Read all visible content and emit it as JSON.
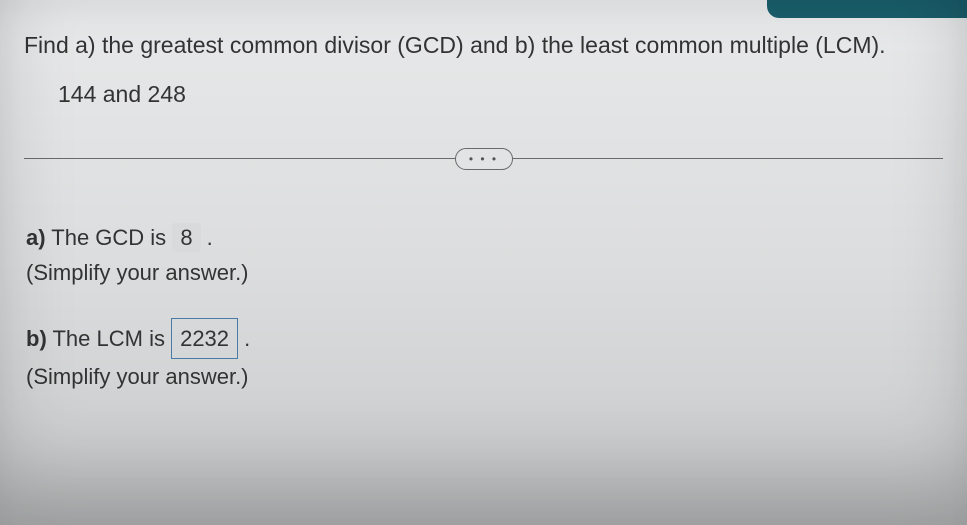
{
  "question": {
    "prompt": "Find a) the greatest common divisor (GCD) and b) the least common multiple (LCM).",
    "numbers": "144 and 248"
  },
  "divider": {
    "label": "• • •"
  },
  "parts": {
    "a": {
      "label": "a)",
      "text_before": " The GCD is ",
      "value": "8",
      "text_after": " .",
      "hint": "(Simplify your answer.)"
    },
    "b": {
      "label": "b)",
      "text_before": " The LCM is ",
      "value": "2232",
      "text_after": " .",
      "hint": "(Simplify your answer.)"
    }
  }
}
